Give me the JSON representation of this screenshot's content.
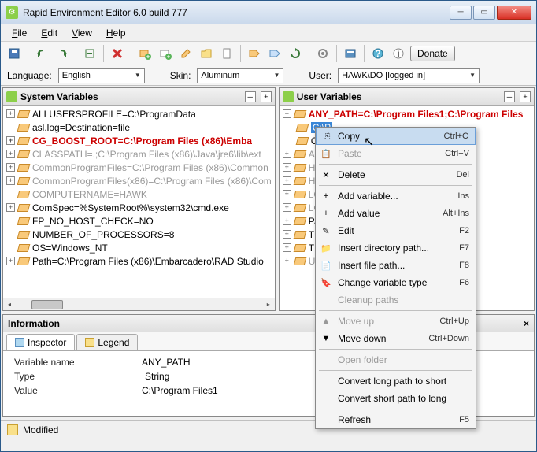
{
  "window": {
    "title": "Rapid Environment Editor 6.0 build 777"
  },
  "menubar": [
    "File",
    "Edit",
    "View",
    "Help"
  ],
  "toolbar": {
    "donate": "Donate"
  },
  "optbar": {
    "language_label": "Language:",
    "language_value": "English",
    "skin_label": "Skin:",
    "skin_value": "Aluminum",
    "user_label": "User:",
    "user_value": "HAWK\\DO [logged in]"
  },
  "panels": {
    "system": {
      "title": "System Variables",
      "rows": [
        {
          "k": "plus",
          "style": "",
          "text": "ALLUSERSPROFILE=C:\\ProgramData"
        },
        {
          "k": "none",
          "style": "",
          "text": "asl.log=Destination=file"
        },
        {
          "k": "plus",
          "style": "red",
          "text": "CG_BOOST_ROOT=C:\\Program Files (x86)\\Emba"
        },
        {
          "k": "plus",
          "style": "grey",
          "text": "CLASSPATH=.;C:\\Program Files (x86)\\Java\\jre6\\lib\\ext"
        },
        {
          "k": "plus",
          "style": "grey",
          "text": "CommonProgramFiles=C:\\Program Files (x86)\\Common"
        },
        {
          "k": "plus",
          "style": "grey",
          "text": "CommonProgramFiles(x86)=C:\\Program Files (x86)\\Com"
        },
        {
          "k": "none",
          "style": "grey",
          "text": "COMPUTERNAME=HAWK"
        },
        {
          "k": "plus",
          "style": "",
          "text": "ComSpec=%SystemRoot%\\system32\\cmd.exe"
        },
        {
          "k": "none",
          "style": "",
          "text": "FP_NO_HOST_CHECK=NO"
        },
        {
          "k": "none",
          "style": "",
          "text": "NUMBER_OF_PROCESSORS=8"
        },
        {
          "k": "none",
          "style": "",
          "text": "OS=Windows_NT"
        },
        {
          "k": "plus",
          "style": "",
          "text": "Path=C:\\Program Files (x86)\\Embarcadero\\RAD Studio"
        }
      ]
    },
    "user": {
      "title": "User Variables",
      "rows": [
        {
          "k": "minus",
          "style": "red",
          "text": "ANY_PATH=C:\\Program Files1;C:\\Program Files"
        },
        {
          "k": "indent",
          "style": "sel",
          "text": "C:\\P"
        },
        {
          "k": "indent",
          "style": "",
          "text": "C:\\P"
        },
        {
          "k": "plus",
          "style": "grey",
          "text": "APPD"
        },
        {
          "k": "plus",
          "style": "grey",
          "text": "HOME"
        },
        {
          "k": "plus",
          "style": "grey",
          "text": "HOME"
        },
        {
          "k": "plus",
          "style": "grey",
          "text": "LOCA"
        },
        {
          "k": "plus",
          "style": "grey",
          "text": "LOGO"
        },
        {
          "k": "plus",
          "style": "",
          "text": "PATH                                 \\Progra"
        },
        {
          "k": "plus",
          "style": "",
          "text": "TEMP                                 %USER"
        },
        {
          "k": "plus",
          "style": "",
          "text": "TMP="
        },
        {
          "k": "plus",
          "style": "grey",
          "text": "USER"
        }
      ]
    }
  },
  "info": {
    "title": "Information",
    "tabs": [
      "Inspector",
      "Legend"
    ],
    "rows": [
      {
        "k": "Variable name",
        "v": "ANY_PATH"
      },
      {
        "k": "Type",
        "v": "String"
      },
      {
        "k": "Value",
        "v": "C:\\Program Files1"
      }
    ]
  },
  "status": {
    "text": "Modified"
  },
  "ctx": [
    {
      "t": "item",
      "label": "Copy",
      "sc": "Ctrl+C",
      "hover": true,
      "icon": "copy"
    },
    {
      "t": "item",
      "label": "Paste",
      "sc": "Ctrl+V",
      "disabled": true,
      "icon": "paste"
    },
    {
      "t": "sep"
    },
    {
      "t": "item",
      "label": "Delete",
      "sc": "Del",
      "icon": "delete"
    },
    {
      "t": "sep"
    },
    {
      "t": "item",
      "label": "Add variable...",
      "sc": "Ins",
      "icon": "addvar"
    },
    {
      "t": "item",
      "label": "Add value",
      "sc": "Alt+Ins",
      "icon": "addval"
    },
    {
      "t": "item",
      "label": "Edit",
      "sc": "F2",
      "icon": "edit"
    },
    {
      "t": "item",
      "label": "Insert directory path...",
      "sc": "F7",
      "icon": "dir"
    },
    {
      "t": "item",
      "label": "Insert file path...",
      "sc": "F8",
      "icon": "file"
    },
    {
      "t": "item",
      "label": "Change variable type",
      "sc": "F6",
      "icon": "type"
    },
    {
      "t": "item",
      "label": "Cleanup paths",
      "disabled": true
    },
    {
      "t": "sep"
    },
    {
      "t": "item",
      "label": "Move up",
      "sc": "Ctrl+Up",
      "disabled": true,
      "icon": "up"
    },
    {
      "t": "item",
      "label": "Move down",
      "sc": "Ctrl+Down",
      "icon": "down"
    },
    {
      "t": "sep"
    },
    {
      "t": "item",
      "label": "Open folder",
      "disabled": true
    },
    {
      "t": "sep"
    },
    {
      "t": "item",
      "label": "Convert long path to short"
    },
    {
      "t": "item",
      "label": "Convert short path to long"
    },
    {
      "t": "sep"
    },
    {
      "t": "item",
      "label": "Refresh",
      "sc": "F5"
    }
  ]
}
